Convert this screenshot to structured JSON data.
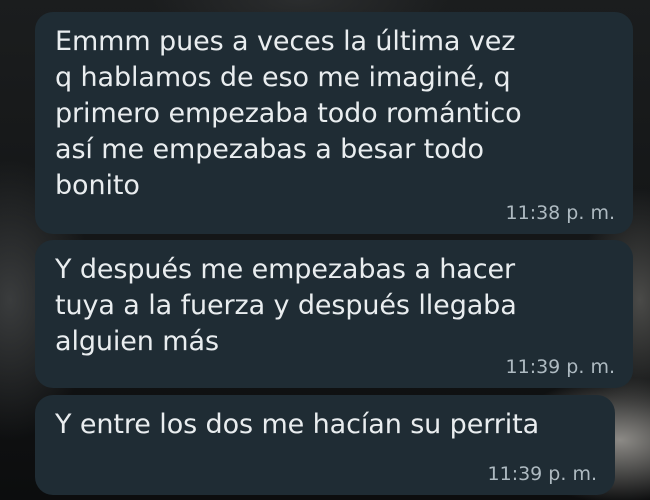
{
  "messages": [
    {
      "text": "Emmm pues a veces la última vez\nq hablamos de eso me imaginé, q\nprimero empezaba todo romántico\nasí me empezabas a besar todo\nbonito",
      "time": "11:38 p. m."
    },
    {
      "text": "Y después me empezabas a hacer\ntuya a la fuerza y después llegaba\nalguien más",
      "time": "11:39 p. m."
    },
    {
      "text": "Y entre los dos me hacían su perrita",
      "time": "11:39 p. m."
    }
  ]
}
